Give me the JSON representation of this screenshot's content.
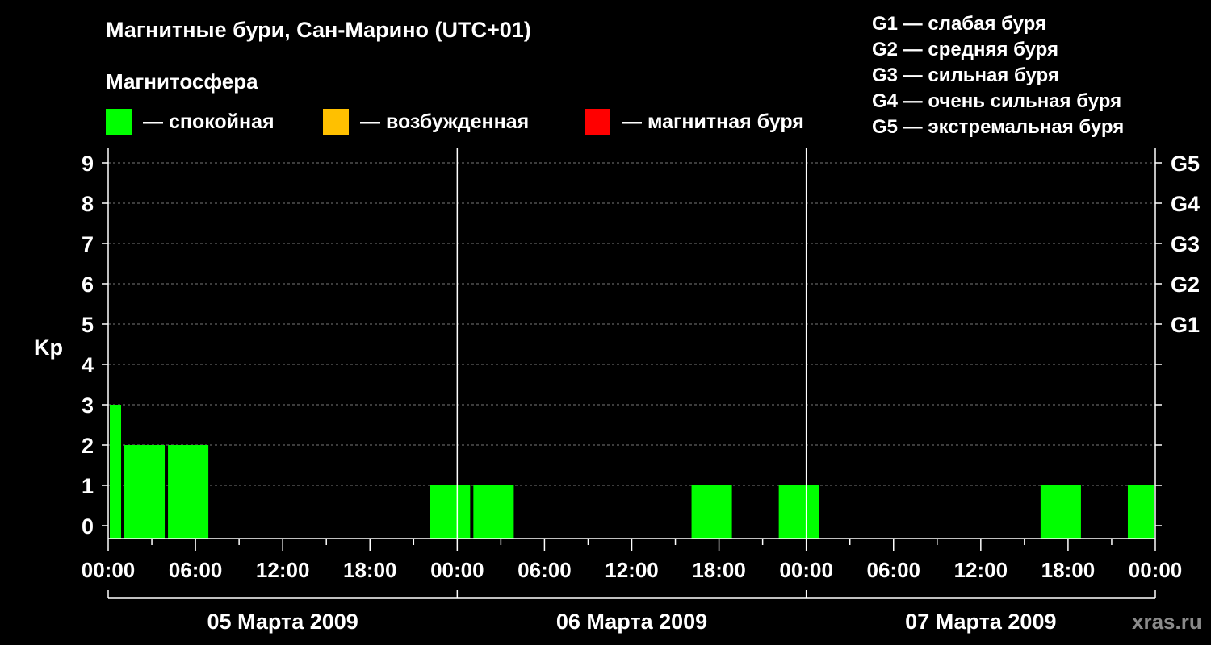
{
  "header": {
    "title": "Магнитные бури, Сан-Марино (UTC+01)",
    "subtitle": "Магнитосфера"
  },
  "legend": [
    {
      "label": "— спокойная",
      "color": "#00ff00"
    },
    {
      "label": "— возбужденная",
      "color": "#ffc000"
    },
    {
      "label": "— магнитная буря",
      "color": "#ff0000"
    }
  ],
  "g_scale": [
    "G1 — слабая буря",
    "G2 — средняя буря",
    "G3 — сильная буря",
    "G4 — очень сильная буря",
    "G5 — экстремальная буря"
  ],
  "watermark": "xras.ru",
  "chart_data": {
    "type": "bar",
    "ylabel": "Kp",
    "ylim": [
      0,
      9
    ],
    "yticks": [
      0,
      1,
      2,
      3,
      4,
      5,
      6,
      7,
      8,
      9
    ],
    "right_ticks": [
      {
        "value": 5,
        "label": "G1"
      },
      {
        "value": 6,
        "label": "G2"
      },
      {
        "value": 7,
        "label": "G3"
      },
      {
        "value": 8,
        "label": "G4"
      },
      {
        "value": 9,
        "label": "G5"
      }
    ],
    "xlim_hours": [
      0,
      72
    ],
    "xtick_labels": [
      "00:00",
      "06:00",
      "12:00",
      "18:00",
      "00:00",
      "06:00",
      "12:00",
      "18:00",
      "00:00",
      "06:00",
      "12:00",
      "18:00",
      "00:00"
    ],
    "days": [
      "05 Марта 2009",
      "06 Марта 2009",
      "07 Марта 2009"
    ],
    "grid_y": true,
    "colors": {
      "quiet": "#00ff00",
      "active": "#ffc000",
      "storm": "#ff0000"
    },
    "bars": [
      {
        "start": 0,
        "end": 1,
        "kp": 3
      },
      {
        "start": 1,
        "end": 4,
        "kp": 2
      },
      {
        "start": 4,
        "end": 7,
        "kp": 2
      },
      {
        "start": 22,
        "end": 25,
        "kp": 1
      },
      {
        "start": 25,
        "end": 28,
        "kp": 1
      },
      {
        "start": 40,
        "end": 43,
        "kp": 1
      },
      {
        "start": 46,
        "end": 49,
        "kp": 1
      },
      {
        "start": 64,
        "end": 67,
        "kp": 1
      },
      {
        "start": 70,
        "end": 72,
        "kp": 1
      }
    ]
  }
}
